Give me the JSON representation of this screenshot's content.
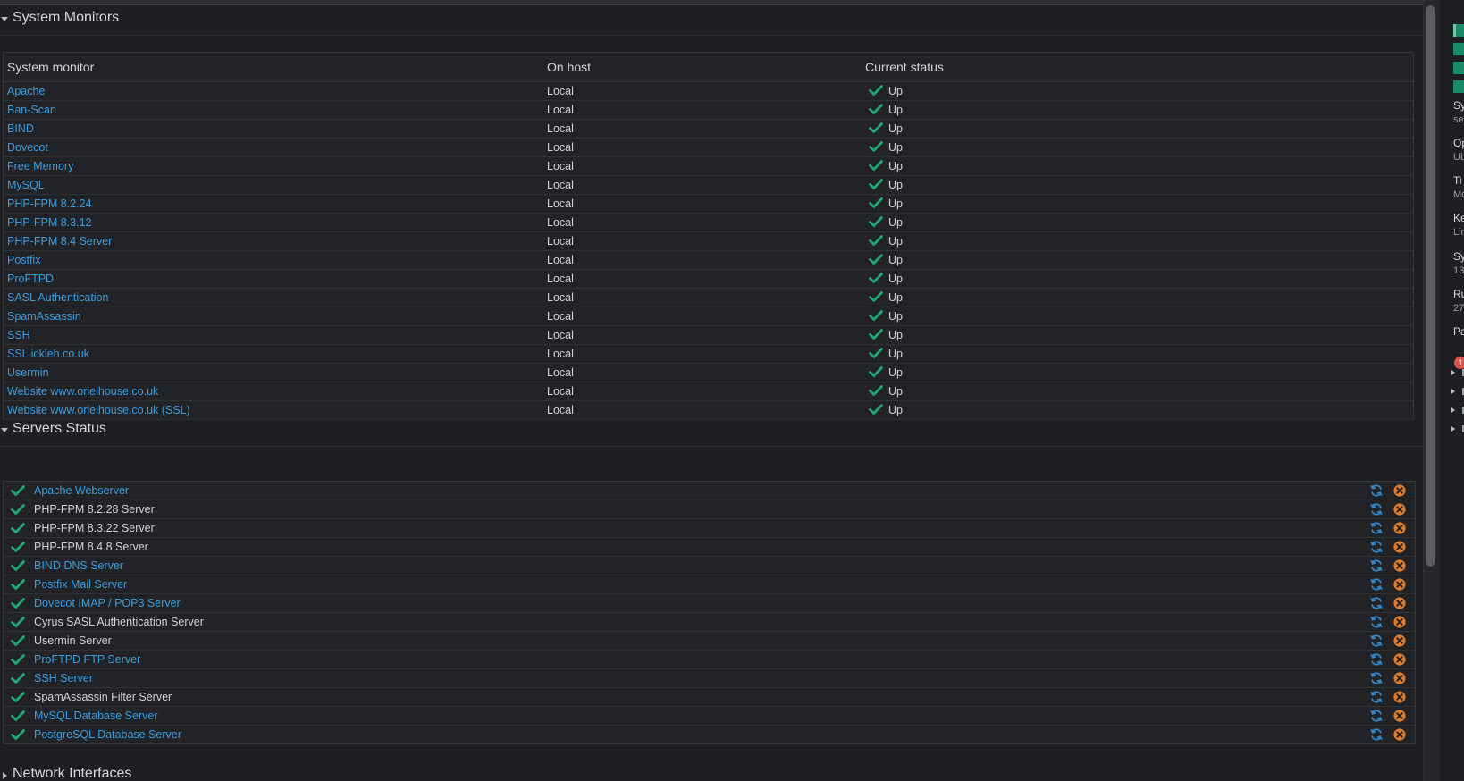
{
  "sections": {
    "monitors": "System Monitors",
    "servers": "Servers Status",
    "network": "Network Interfaces"
  },
  "monitors": {
    "headers": [
      "System monitor",
      "On host",
      "Current status"
    ],
    "rows": [
      {
        "name": "Apache",
        "host": "Local",
        "status": "Up"
      },
      {
        "name": "Ban-Scan",
        "host": "Local",
        "status": "Up"
      },
      {
        "name": "BIND",
        "host": "Local",
        "status": "Up"
      },
      {
        "name": "Dovecot",
        "host": "Local",
        "status": "Up"
      },
      {
        "name": "Free Memory",
        "host": "Local",
        "status": "Up"
      },
      {
        "name": "MySQL",
        "host": "Local",
        "status": "Up"
      },
      {
        "name": "PHP-FPM 8.2.24",
        "host": "Local",
        "status": "Up"
      },
      {
        "name": "PHP-FPM 8.3.12",
        "host": "Local",
        "status": "Up"
      },
      {
        "name": "PHP-FPM 8.4 Server",
        "host": "Local",
        "status": "Up"
      },
      {
        "name": "Postfix",
        "host": "Local",
        "status": "Up"
      },
      {
        "name": "ProFTPD",
        "host": "Local",
        "status": "Up"
      },
      {
        "name": "SASL Authentication",
        "host": "Local",
        "status": "Up"
      },
      {
        "name": "SpamAssassin",
        "host": "Local",
        "status": "Up"
      },
      {
        "name": "SSH",
        "host": "Local",
        "status": "Up"
      },
      {
        "name": "SSL ickleh.co.uk",
        "host": "Local",
        "status": "Up"
      },
      {
        "name": "Usermin",
        "host": "Local",
        "status": "Up"
      },
      {
        "name": "Website www.orielhouse.co.uk",
        "host": "Local",
        "status": "Up"
      },
      {
        "name": "Website www.orielhouse.co.uk (SSL)",
        "host": "Local",
        "status": "Up"
      }
    ]
  },
  "servers": [
    {
      "name": "Apache Webserver",
      "link": true
    },
    {
      "name": "PHP-FPM 8.2.28 Server",
      "link": false
    },
    {
      "name": "PHP-FPM 8.3.22 Server",
      "link": false
    },
    {
      "name": "PHP-FPM 8.4.8 Server",
      "link": false
    },
    {
      "name": "BIND DNS Server",
      "link": true
    },
    {
      "name": "Postfix Mail Server",
      "link": true
    },
    {
      "name": "Dovecot IMAP / POP3 Server",
      "link": true
    },
    {
      "name": "Cyrus SASL Authentication Server",
      "link": false
    },
    {
      "name": "Usermin Server",
      "link": false
    },
    {
      "name": "ProFTPD FTP Server",
      "link": true
    },
    {
      "name": "SSH Server",
      "link": true
    },
    {
      "name": "SpamAssassin Filter Server",
      "link": false
    },
    {
      "name": "MySQL Database Server",
      "link": true
    },
    {
      "name": "PostgreSQL Database Server",
      "link": true
    }
  ],
  "right_panel": {
    "labels": [
      "Sy",
      "Op",
      "Ti",
      "Ke",
      "Sy",
      "Ru",
      "Pa"
    ],
    "values": [
      "se",
      "Ub",
      "Mo",
      "Lin",
      "13",
      "27"
    ],
    "badge": "1"
  },
  "icons": {
    "status": "check-icon",
    "restart": "restart-icon",
    "stop": "stop-icon"
  },
  "colors": {
    "link": "#3a9de0",
    "check": "#1fa876",
    "restart": "#2f86c9",
    "stop": "#e07b2b",
    "background": "#1e1f22"
  }
}
